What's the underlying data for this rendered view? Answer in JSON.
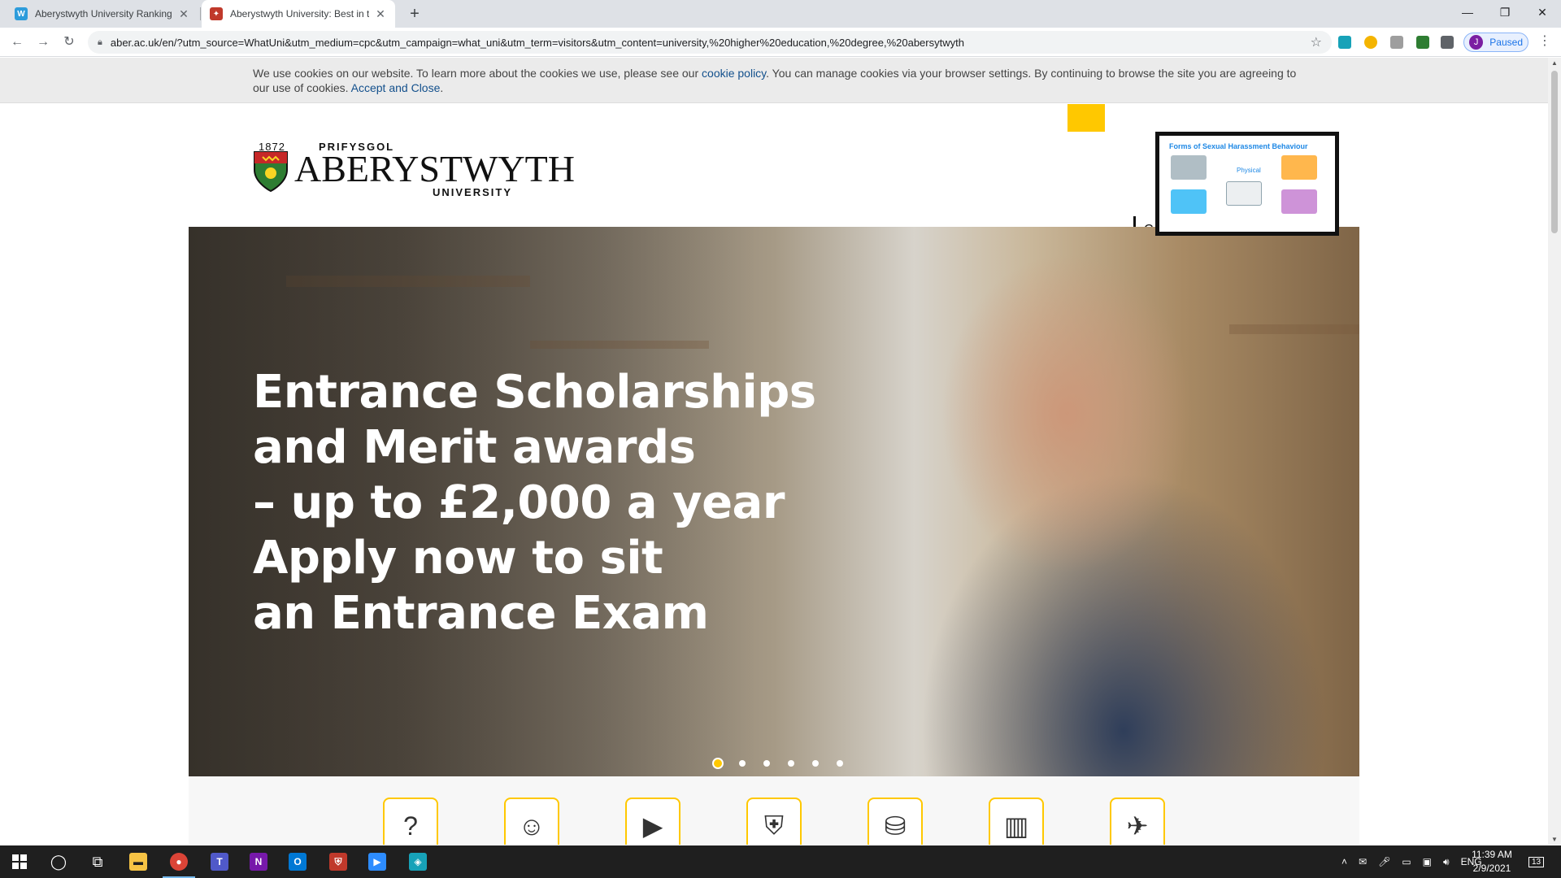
{
  "browser": {
    "tabs": [
      {
        "title": "Aberystwyth University Ranking",
        "favicon_color": "#2d9cdb",
        "favicon_glyph": "W"
      },
      {
        "title": "Aberystwyth University: Best in th",
        "favicon_color": "#c0392b",
        "favicon_glyph": "✦"
      }
    ],
    "url": "aber.ac.uk/en/?utm_source=WhatUni&utm_medium=cpc&utm_campaign=what_uni&utm_term=visitors&utm_content=university,%20higher%20education,%20degree,%20abersytwyth",
    "profile_initial": "J",
    "profile_status": "Paused"
  },
  "cookie_banner": {
    "text_before": "We use cookies on our website. To learn more about the cookies we use, please see our ",
    "policy_link": "cookie policy",
    "text_after": ". You can manage cookies via your browser settings. By continuing to browse the site you are agreeing to our use of cookies. ",
    "accept_link": "Accept and Close",
    "trailing": "."
  },
  "header": {
    "logo_year": "1872",
    "logo_top": "PRIFYSGOL",
    "logo_main": "ABERYSTWYTH",
    "logo_bottom": "UNIVERSITY",
    "nav_partial": "C"
  },
  "pip_video": {
    "title": "Forms of Sexual Harassment Behaviour",
    "label": "Physical"
  },
  "hero": {
    "lines": [
      "Entrance Scholarships",
      "and Merit awards",
      "– up to £2,000 a year",
      "Apply now to sit",
      "an Entrance Exam"
    ],
    "slides_total": 6,
    "active_slide": 1
  },
  "quick_links": [
    {
      "icon": "question-icon"
    },
    {
      "icon": "graduate-icon"
    },
    {
      "icon": "video-play-icon"
    },
    {
      "icon": "crest-icon"
    },
    {
      "icon": "coins-icon"
    },
    {
      "icon": "books-icon"
    },
    {
      "icon": "airplane-icon"
    }
  ],
  "taskbar": {
    "language": "ENG",
    "time": "11:39 AM",
    "date": "2/9/2021",
    "notifications": "13"
  },
  "colors": {
    "accent_yellow": "#ffc800",
    "link_blue": "#13508c"
  }
}
